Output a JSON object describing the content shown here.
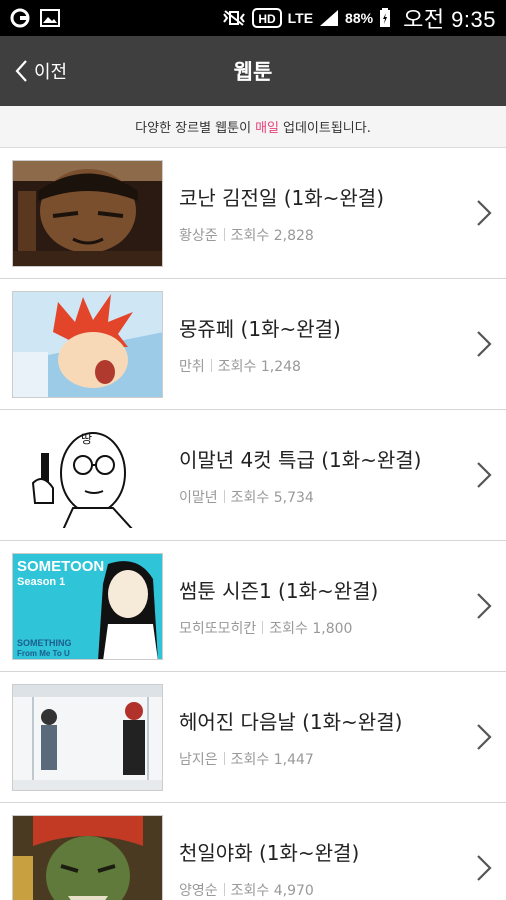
{
  "status_bar": {
    "battery": "88%",
    "time": "오전 9:35",
    "network": "LTE",
    "icons": [
      "notification-icon",
      "image-icon",
      "vibrate-mute-icon",
      "hd-icon",
      "lte-icon",
      "signal-icon",
      "battery-icon"
    ]
  },
  "toolbar": {
    "back_label": "이전",
    "title": "웹툰"
  },
  "notice": {
    "prefix": "다양한 장르별 웹툰이",
    "highlight": "매일",
    "suffix": "업데이트됩니다.",
    "highlight_color": "#e8447a"
  },
  "webtoons": [
    {
      "title": "코난 김전일 (1화~완결)",
      "author": "황상준",
      "views": "조회수 2,828"
    },
    {
      "title": "몽쥬페 (1화~완결)",
      "author": "만취",
      "views": "조회수 1,248"
    },
    {
      "title": "이말년 4컷 특급 (1화~완결)",
      "author": "이말년",
      "views": "조회수 5,734"
    },
    {
      "title": "썸툰 시즌1 (1화~완결)",
      "author": "모히또모히칸",
      "views": "조회수 1,800"
    },
    {
      "title": "헤어진 다음날 (1화~완결)",
      "author": "남지은",
      "views": "조회수 1,447"
    },
    {
      "title": "천일야화 (1화~완결)",
      "author": "양영순",
      "views": "조회수 4,970"
    }
  ],
  "thumbnail_text": {
    "sometoon_title": "SOMETOON",
    "sometoon_season": "Season 1",
    "sometoon_tag1": "SOMETHING",
    "sometoon_tag2": "From Me To U",
    "ddang": "땅"
  }
}
